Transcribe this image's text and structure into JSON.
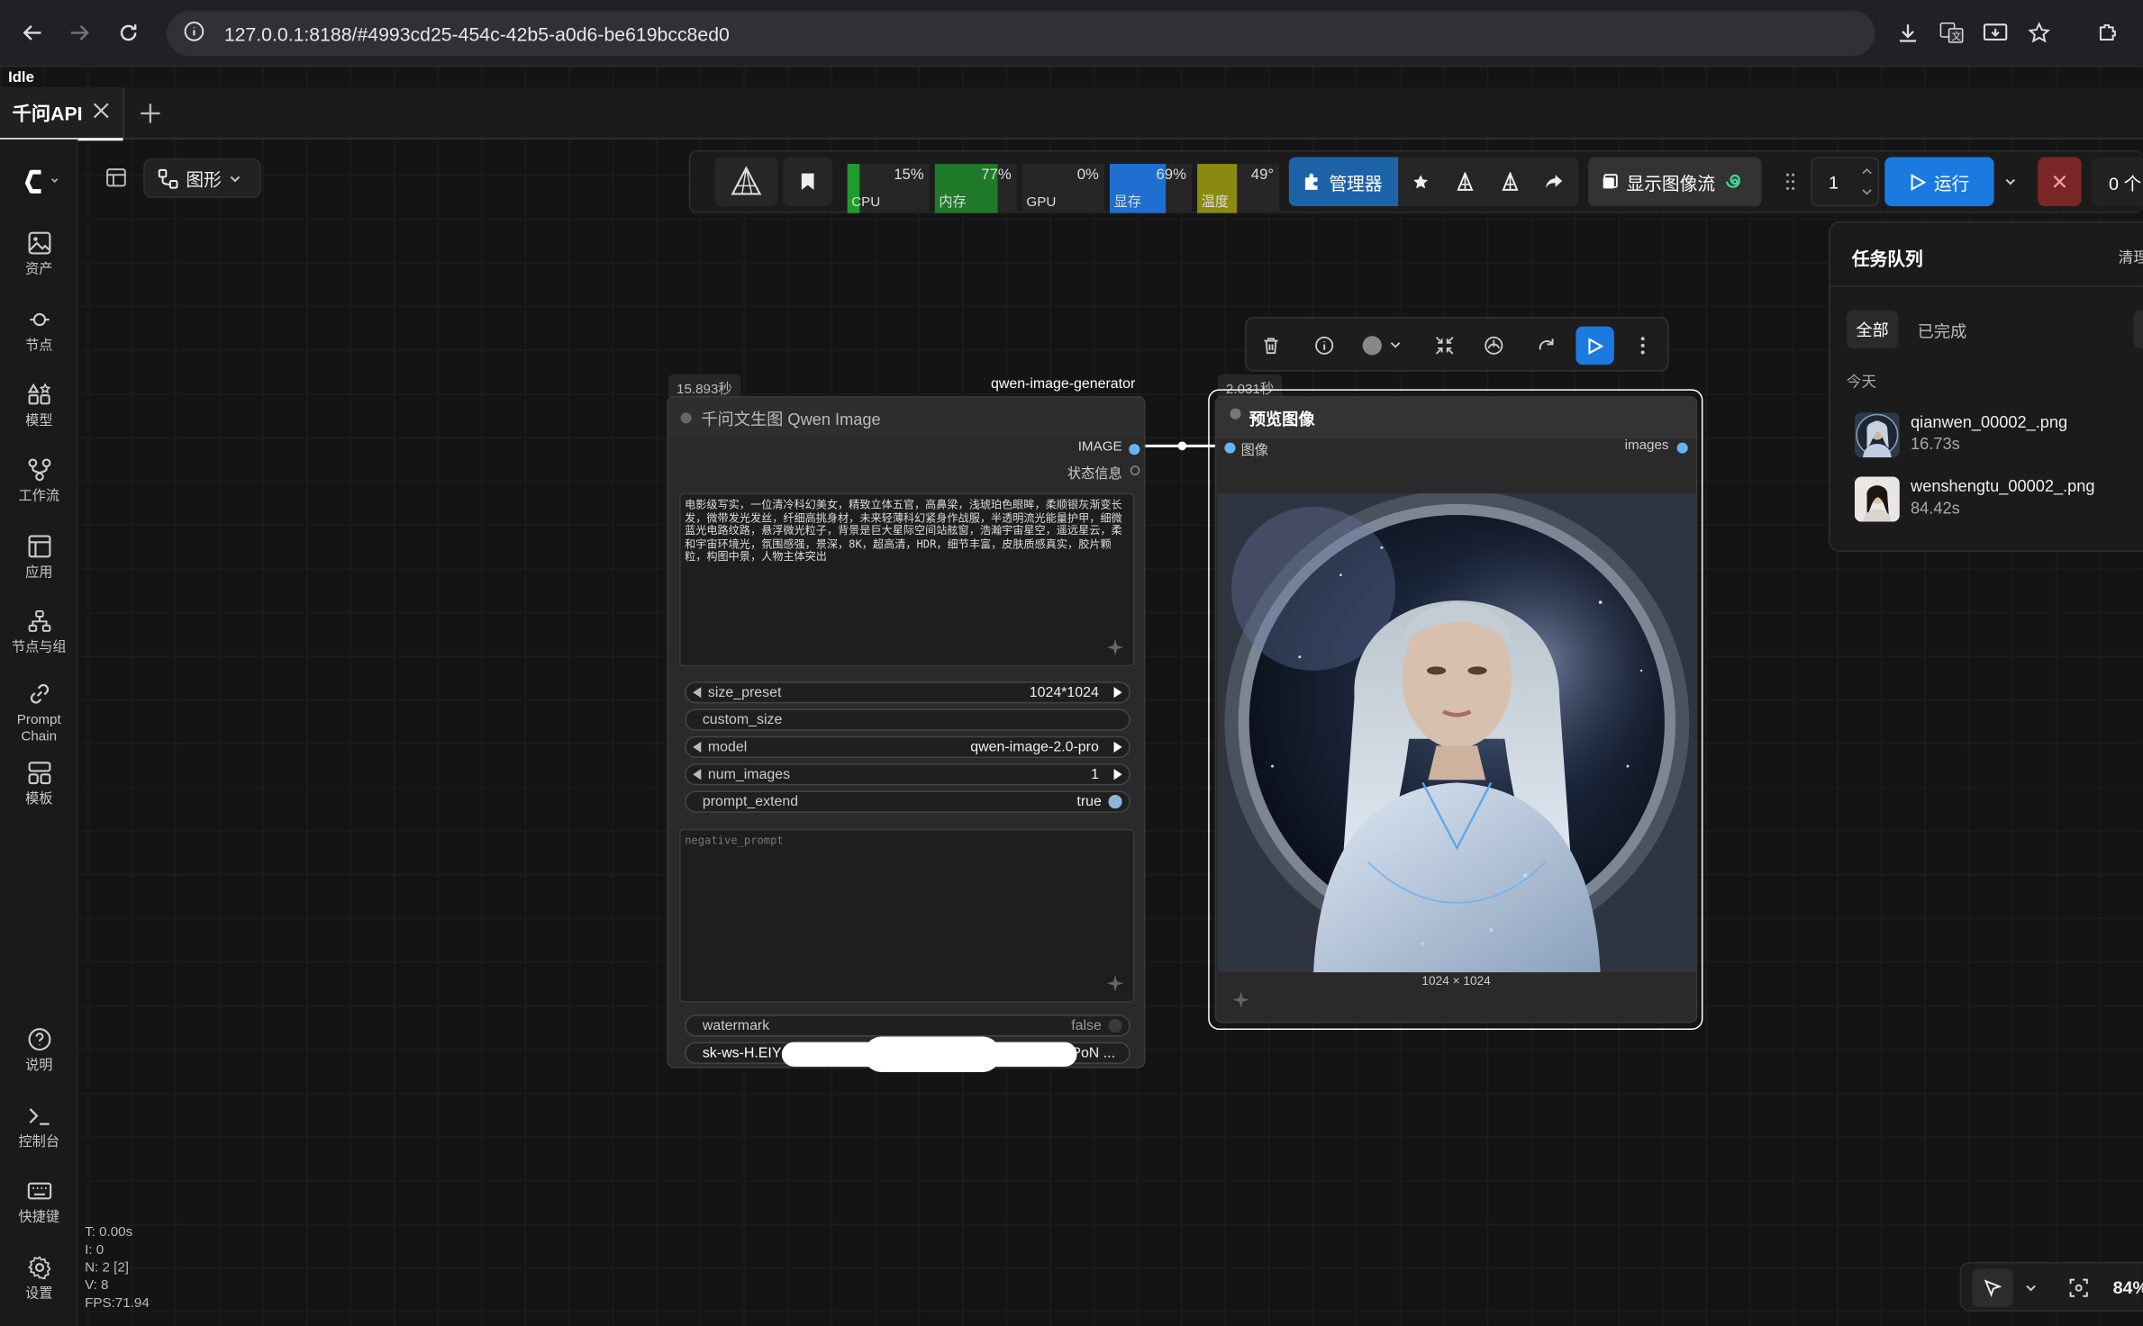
{
  "browser": {
    "url": "127.0.0.1:8188/#4993cd25-454c-42b5-a0d6-be619bcc8ed0"
  },
  "app": {
    "status": "Idle",
    "tab_label": "千问API"
  },
  "sidebar": {
    "items": [
      {
        "label": "资产",
        "icon": "image-icon"
      },
      {
        "label": "节点",
        "icon": "node-icon"
      },
      {
        "label": "模型",
        "icon": "model-icon"
      },
      {
        "label": "工作流",
        "icon": "workflow-icon"
      },
      {
        "label": "应用",
        "icon": "app-icon"
      },
      {
        "label": "节点与组",
        "icon": "node-group-icon"
      },
      {
        "label": "Prompt Chain",
        "icon": "link-icon"
      },
      {
        "label": "模板",
        "icon": "template-icon"
      }
    ],
    "bottom": [
      {
        "label": "说明",
        "icon": "help-icon"
      },
      {
        "label": "控制台",
        "icon": "terminal-icon"
      },
      {
        "label": "快捷键",
        "icon": "keyboard-icon"
      },
      {
        "label": "设置",
        "icon": "gear-icon"
      }
    ]
  },
  "graph_menu": {
    "label": "图形"
  },
  "toolbar": {
    "cpu": {
      "label": "CPU",
      "value": "15%",
      "fraction": 0.15,
      "color": "#1f9c2e"
    },
    "ram": {
      "label": "内存",
      "value": "77%",
      "fraction": 0.77,
      "color": "#1f7a2a"
    },
    "gpu": {
      "label": "GPU",
      "value": "0%",
      "fraction": 0.0,
      "color": "#2a2a2a"
    },
    "vram": {
      "label": "显存",
      "value": "69%",
      "fraction": 0.69,
      "color": "#1e6fd0"
    },
    "temp": {
      "label": "温度",
      "value": "49°",
      "fraction": 0.49,
      "color": "#8a8a10"
    },
    "manager_label": "管理器",
    "show_flow_label": "显示图像流",
    "batch_count": "1",
    "run_label": "运行",
    "queue_count": "0 个"
  },
  "queue_panel": {
    "title": "任务队列",
    "clear_label": "清理",
    "tab_all": "全部",
    "tab_done": "已完成",
    "group_today": "今天",
    "items": [
      {
        "name": "qianwen_00002_.png",
        "time": "16.73s"
      },
      {
        "name": "wenshengtu_00002_.png",
        "time": "84.42s"
      }
    ]
  },
  "node_qwen": {
    "time_badge": "15.893秒",
    "group_tag": "qwen-image-generator",
    "title": "千问文生图 Qwen Image",
    "outputs": [
      "IMAGE",
      "状态信息"
    ],
    "prompt": "电影级写实，一位清冷科幻美女，精致立体五官，高鼻梁，浅琥珀色眼眸，柔顺银灰渐变长发，微带发光发丝，纤细高挑身材，未来轻薄科幻紧身作战服，半透明流光能量护甲，细微蓝光电路纹路，悬浮微光粒子，背景是巨大星际空间站舷窗，浩瀚宇宙星空，遥远星云，柔和宇宙环境光，氛围感强，景深，8K，超高清，HDR，细节丰富，皮肤质感真实，胶片颗粒，构图中景，人物主体突出",
    "widgets": [
      {
        "name": "size_preset",
        "value": "1024*1024"
      },
      {
        "name": "custom_size",
        "value": ""
      },
      {
        "name": "model",
        "value": "qwen-image-2.0-pro"
      },
      {
        "name": "num_images",
        "value": "1"
      },
      {
        "name": "prompt_extend",
        "value": "true"
      }
    ],
    "negative_placeholder": "negative_prompt",
    "watermark": {
      "name": "watermark",
      "value": "false"
    },
    "api_key_start": "sk-ws-H.EIY",
    "api_key_end": "PoN ..."
  },
  "node_preview": {
    "time_badge": "2.031秒",
    "title": "预览图像",
    "input_label": "图像",
    "output_label": "images",
    "image_size": "1024 × 1024"
  },
  "stats": {
    "t": "T: 0.00s",
    "i": "I: 0",
    "n": "N: 2 [2]",
    "v": "V: 8",
    "fps": "FPS:71.94"
  },
  "canvas": {
    "zoom": "84%"
  }
}
